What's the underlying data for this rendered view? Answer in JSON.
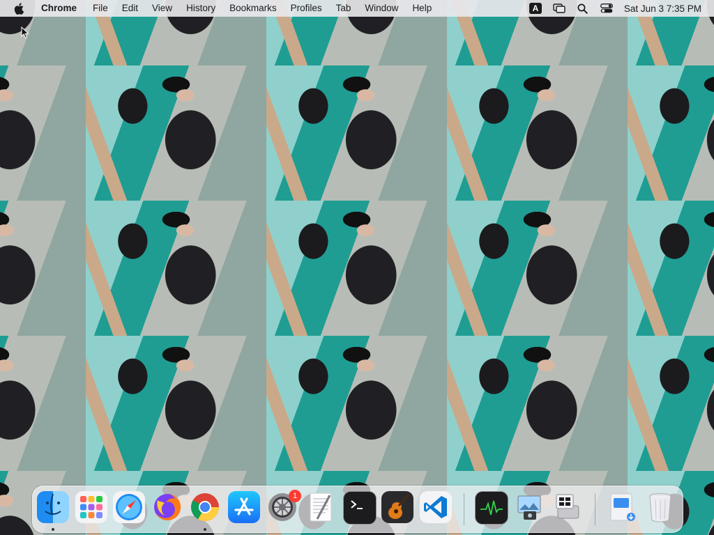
{
  "menubar": {
    "app_name": "Chrome",
    "items": [
      "File",
      "Edit",
      "View",
      "History",
      "Bookmarks",
      "Profiles",
      "Tab",
      "Window",
      "Help"
    ],
    "input_source": "A",
    "clock": "Sat Jun 3  7:35 PM"
  },
  "dock": {
    "apps": [
      {
        "name": "Finder",
        "running": true
      },
      {
        "name": "Launchpad",
        "running": false
      },
      {
        "name": "Safari",
        "running": false
      },
      {
        "name": "Firefox",
        "running": false
      },
      {
        "name": "Google Chrome",
        "running": true
      },
      {
        "name": "App Store",
        "running": false
      },
      {
        "name": "System Preferences",
        "running": false,
        "badge": "1"
      },
      {
        "name": "TextEdit",
        "running": false
      },
      {
        "name": "Terminal",
        "running": false
      },
      {
        "name": "GarageBand",
        "running": false
      },
      {
        "name": "Visual Studio Code",
        "running": false
      }
    ],
    "utilities": [
      {
        "name": "Activity Monitor"
      },
      {
        "name": "Preview"
      },
      {
        "name": "Boot Camp Assistant"
      }
    ],
    "stacks": [
      {
        "name": "Downloads"
      },
      {
        "name": "Trash"
      }
    ]
  },
  "colors": {
    "menubar_bg": "#e8e8eb",
    "badge": "#ff3b30",
    "wallpaper_teal": "#2aa39a"
  }
}
